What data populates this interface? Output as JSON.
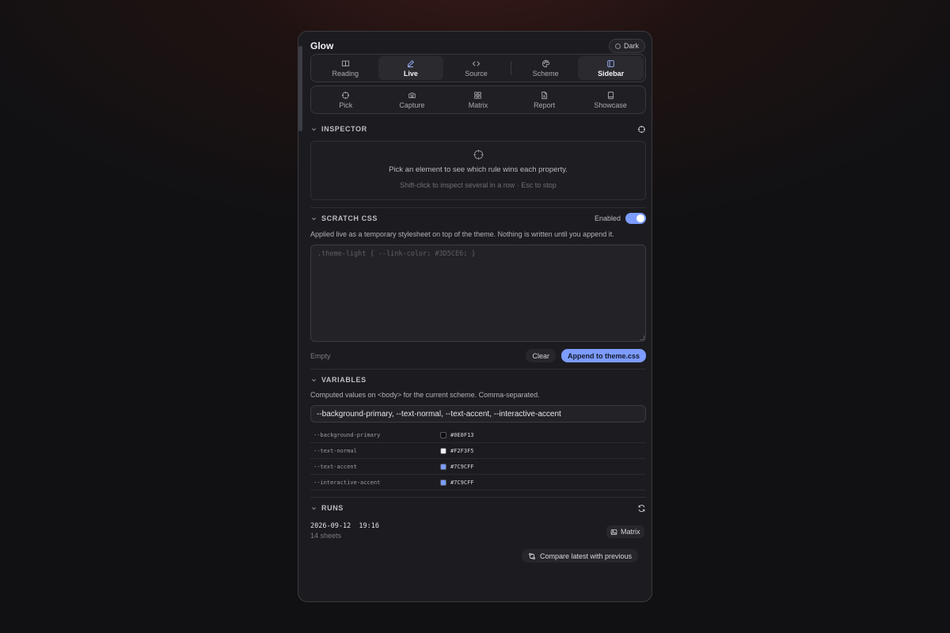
{
  "app": {
    "title": "Glow",
    "theme_label": "Dark"
  },
  "tabs_primary": [
    {
      "label": "Reading",
      "icon": "book-icon",
      "active": false
    },
    {
      "label": "Live",
      "icon": "pen-icon",
      "active": true
    },
    {
      "label": "Source",
      "icon": "code-icon",
      "active": false
    },
    {
      "label": "Scheme",
      "icon": "palette-icon",
      "active": false
    },
    {
      "label": "Sidebar",
      "icon": "sidebar-icon",
      "active": true
    }
  ],
  "tabs_secondary": [
    {
      "label": "Pick",
      "icon": "crosshair-icon"
    },
    {
      "label": "Capture",
      "icon": "camera-icon"
    },
    {
      "label": "Matrix",
      "icon": "grid-icon"
    },
    {
      "label": "Report",
      "icon": "file-icon"
    },
    {
      "label": "Showcase",
      "icon": "tablet-icon"
    }
  ],
  "inspector": {
    "title": "INSPECTOR",
    "message": "Pick an element to see which rule wins each property.",
    "hint": "Shift-click to inspect several in a row · Esc to stop"
  },
  "scratch": {
    "title": "SCRATCH CSS",
    "toggle_label": "Enabled",
    "enabled": true,
    "description": "Applied live as a temporary stylesheet on top of the theme. Nothing is written until you append it.",
    "placeholder": ".theme-light { --link-color: #3D5CE6; }",
    "status": "Empty",
    "clear_label": "Clear",
    "append_label": "Append to theme.css"
  },
  "variables": {
    "title": "VARIABLES",
    "description": "Computed values on <body> for the current scheme. Comma-separated.",
    "input_value": "--background-primary, --text-normal, --text-accent, --interactive-accent",
    "rows": [
      {
        "name": "--background-primary",
        "value": "#0E0F13",
        "swatch": "#0E0F13"
      },
      {
        "name": "--text-normal",
        "value": "#F2F3F5",
        "swatch": "#F2F3F5"
      },
      {
        "name": "--text-accent",
        "value": "#7C9CFF",
        "swatch": "#7C9CFF"
      },
      {
        "name": "--interactive-accent",
        "value": "#7C9CFF",
        "swatch": "#7C9CFF"
      }
    ]
  },
  "runs": {
    "title": "RUNS",
    "entry_date": "2026-09-12  19:16",
    "entry_sheets": "14 sheets",
    "matrix_label": "Matrix",
    "compare_label": "Compare latest with previous"
  },
  "colors": {
    "accent": "#7C9CFF",
    "panel": "#1C1C20"
  }
}
